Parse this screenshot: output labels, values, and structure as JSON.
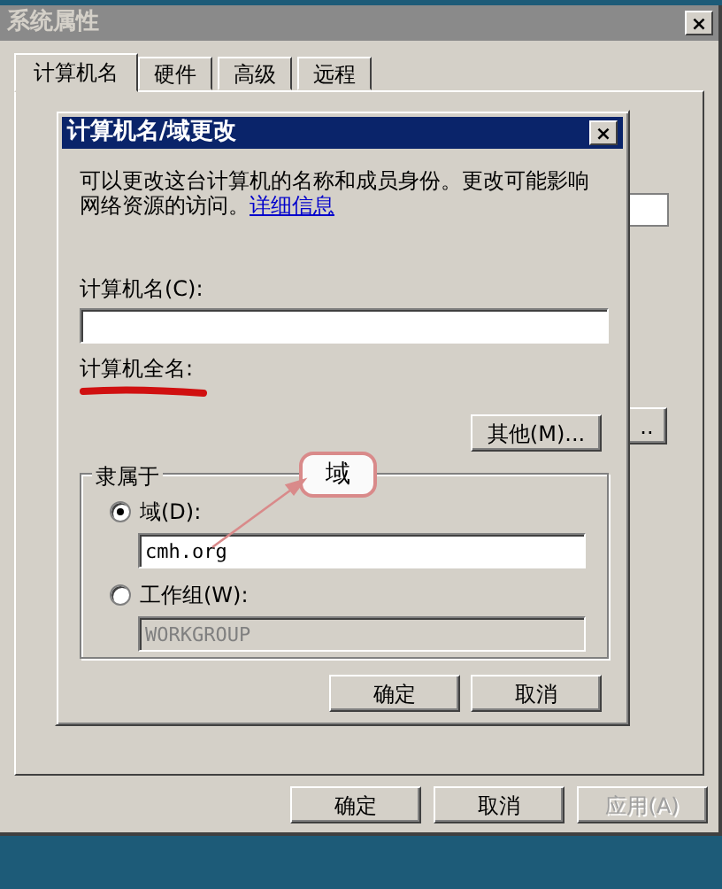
{
  "window": {
    "title": "系统属性",
    "close": "×"
  },
  "tabs": [
    {
      "label": "计算机名",
      "selected": true
    },
    {
      "label": "硬件",
      "selected": false
    },
    {
      "label": "高级",
      "selected": false
    },
    {
      "label": "远程",
      "selected": false
    }
  ],
  "panel": {
    "button_partial": ".."
  },
  "dialog": {
    "title": "计算机名/域更改",
    "close": "×",
    "description": "可以更改这台计算机的名称和成员身份。更改可能影响网络资源的访问。",
    "link": "详细信息",
    "computer_name_label": "计算机名(C):",
    "full_name_label": "计算机全名:",
    "more_button": "其他(M)...",
    "member_of": {
      "legend": "隶属于",
      "options": [
        {
          "label": "域(D):",
          "selected": true,
          "value": "cmh.org",
          "disabled": false
        },
        {
          "label": "工作组(W):",
          "selected": false,
          "value": "WORKGROUP",
          "disabled": true
        }
      ]
    },
    "buttons": [
      "确定",
      "取消"
    ]
  },
  "callout": {
    "text": "域"
  },
  "buttons": [
    {
      "label": "确定",
      "disabled": false
    },
    {
      "label": "取消",
      "disabled": false
    },
    {
      "label": "应用(A)",
      "disabled": true
    }
  ]
}
